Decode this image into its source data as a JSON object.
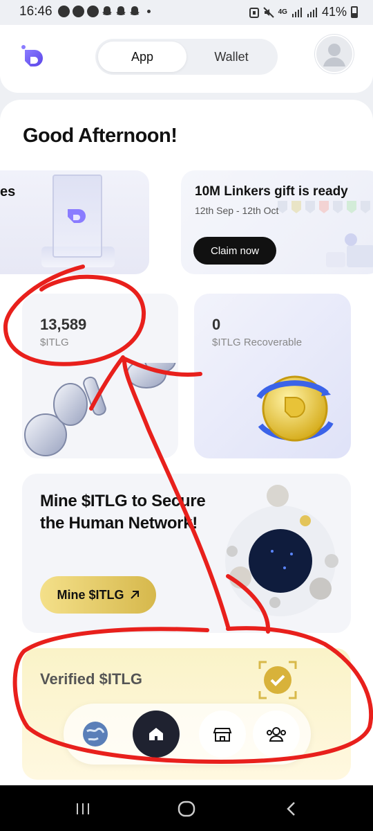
{
  "status_bar": {
    "time": "16:46",
    "network": "4G",
    "battery": "41%"
  },
  "header": {
    "tabs": [
      {
        "label": "App",
        "active": true
      },
      {
        "label": "Wallet",
        "active": false
      }
    ]
  },
  "main": {
    "greeting": "Good Afternoon!",
    "promo_left": {
      "text": "es"
    },
    "promo": {
      "title": "10M Linkers gift is ready",
      "date_range": "12th Sep - 12th Oct",
      "button": "Claim now"
    },
    "balance": {
      "value": "13,589",
      "unit": "$ITLG"
    },
    "recoverable": {
      "value": "0",
      "unit": "$ITLG Recoverable"
    },
    "mine": {
      "title": "Mine $ITLG to Secure the Human Network!",
      "button": "Mine $ITLG",
      "button_icon": "arrow-up-right-icon"
    },
    "verified": {
      "title": "Verified $ITLG"
    }
  },
  "bottom_nav": {
    "items": [
      "earth-icon",
      "home-icon",
      "store-icon",
      "people-icon"
    ],
    "active": "home-icon"
  },
  "colors": {
    "accent": "#6b5cf5",
    "gold": "#e3c45a",
    "annotation_red": "#e8201c",
    "dark": "#1f2230"
  }
}
